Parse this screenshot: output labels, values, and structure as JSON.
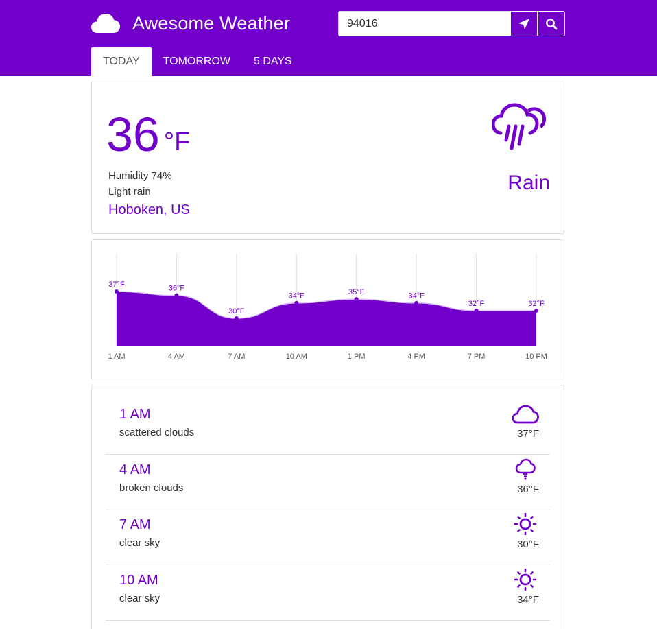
{
  "app": {
    "title": "Awesome Weather",
    "brand_icon": "cloud-icon"
  },
  "search": {
    "value": "94016",
    "placeholder": "",
    "locate_icon": "location-arrow-icon",
    "search_icon": "search-icon"
  },
  "tabs": [
    {
      "label": "TODAY",
      "active": true
    },
    {
      "label": "TOMORROW",
      "active": false
    },
    {
      "label": "5 DAYS",
      "active": false
    }
  ],
  "current": {
    "temperature": "36",
    "unit": "°F",
    "humidity": "Humidity 74%",
    "description": "Light rain",
    "location": "Hoboken, US",
    "condition": "Rain",
    "icon": "rain-cloud-icon"
  },
  "colors": {
    "accent": "#7200ca",
    "border": "#dddddd",
    "text": "#333333"
  },
  "chart_data": {
    "type": "area",
    "categories": [
      "1 AM",
      "4 AM",
      "7 AM",
      "10 AM",
      "1 PM",
      "4 PM",
      "7 PM",
      "10 PM"
    ],
    "values": [
      37,
      36,
      30,
      34,
      35,
      34,
      32,
      32
    ],
    "value_labels": [
      "37°F",
      "36°F",
      "30°F",
      "34°F",
      "35°F",
      "34°F",
      "32°F",
      "32°F"
    ],
    "title": "",
    "xlabel": "",
    "ylabel": "",
    "grid": "vertical"
  },
  "hourly": [
    {
      "time": "1 AM",
      "description": "scattered clouds",
      "temp": "37°F",
      "icon": "cloud-icon"
    },
    {
      "time": "4 AM",
      "description": "broken clouds",
      "temp": "36°F",
      "icon": "lightbulb-icon"
    },
    {
      "time": "7 AM",
      "description": "clear sky",
      "temp": "30°F",
      "icon": "sun-icon"
    },
    {
      "time": "10 AM",
      "description": "clear sky",
      "temp": "34°F",
      "icon": "sun-icon"
    }
  ]
}
